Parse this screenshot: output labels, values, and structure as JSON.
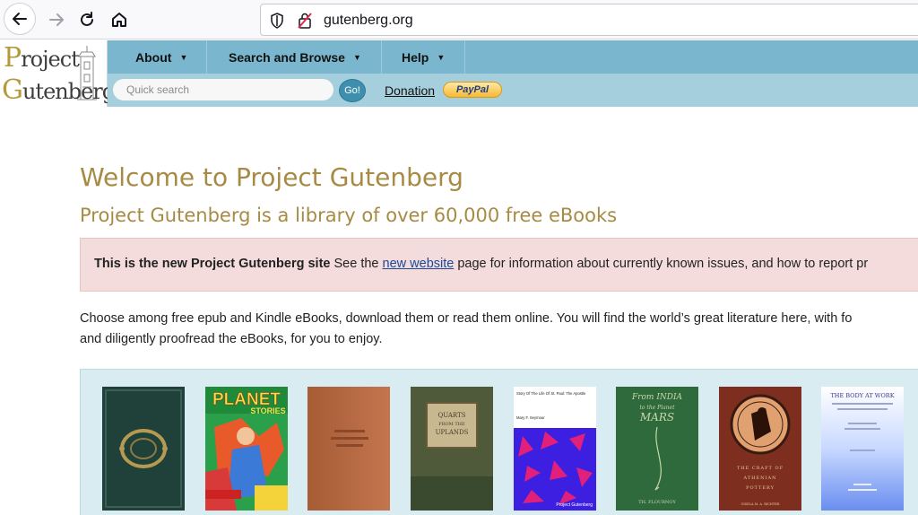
{
  "browser": {
    "url": "gutenberg.org"
  },
  "logo": {
    "line1_cap": "P",
    "line1_rest": "roject",
    "line2_cap": "G",
    "line2_rest": "utenberg"
  },
  "menu": {
    "items": [
      {
        "label": "About"
      },
      {
        "label": "Search and Browse"
      },
      {
        "label": "Help"
      }
    ]
  },
  "subbar": {
    "search_placeholder": "Quick search",
    "go_label": "Go!",
    "donation_label": "Donation",
    "paypal_label": "PayPal"
  },
  "main": {
    "title": "Welcome to Project Gutenberg",
    "subtitle": "Project Gutenberg is a library of over 60,000 free eBooks",
    "notice": {
      "bold": "This is the new Project Gutenberg site",
      "before_link": " See the ",
      "link": "new website",
      "after_link": " page for information about currently known issues, and how to report pr"
    },
    "intro_line1": "Choose among free epub and Kindle eBooks, download them or read them online. You will find the world’s great literature here, with fo",
    "intro_line2": "and diligently proofread the eBooks, for you to enjoy."
  },
  "books": {
    "covers": [
      {
        "title": "",
        "color": "#1f3a34"
      },
      {
        "title": "PLANET",
        "sub": "STORIES",
        "color": "#1c8a3c"
      },
      {
        "title": "",
        "color": "#b5623a"
      },
      {
        "title": "QUARTS",
        "sub": "UPLANDS",
        "color": "#4a5638"
      },
      {
        "title": "Story Of The Life Of St. Paul: The Apostle",
        "author": "Mary F. Seymour",
        "footer": "Project Gutenberg",
        "color": "#3b1fd6"
      },
      {
        "title": "From INDIA to the Planet MARS",
        "author": "TH. FLOURNOY",
        "color": "#2e6b3c"
      },
      {
        "title": "THE CRAFT OF ATHENIAN POTTERY",
        "author": "GISELA M. A. RICHTER",
        "color": "#7a2a1c"
      },
      {
        "title": "THE BODY AT WORK",
        "color": "#8fb0f0"
      }
    ]
  }
}
